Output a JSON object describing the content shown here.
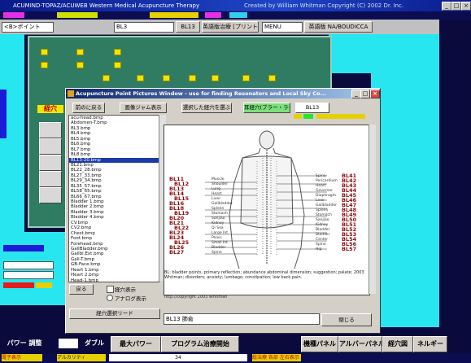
{
  "main_window": {
    "title": "ACUMIND-TOPAZ/ACUWEB   Western Medical Acupuncture Therapy",
    "subtitle": "Created by William Whitman  Copyright (C) 2002 Dr. Inc."
  },
  "toolbar": {
    "field_left": "<B>ポイント",
    "field_mid": "BL3",
    "button_1": "BL13",
    "button_2": "英語版治療 [プリントルーチン]",
    "field_3": "MENU",
    "button_4": "英語版 NA/BOUDICCA"
  },
  "green_panel": {
    "side_label": "経穴"
  },
  "acu_window": {
    "title": "Acupuncture Point Pictures Window - use for finding Resonators and Local Sky Co...",
    "buttons": {
      "prev": "前のに戻る",
      "view": "画像ジャム表示",
      "select_all": "選択した経穴を選ぶ",
      "ear": "耳経穴(ブラー・ラーズ)",
      "code": "BL13"
    },
    "checkbox_label": "経穴番号表示",
    "files": [
      "acu-head.bmp",
      "Abdomen-T.bmp",
      "BL3.bmp",
      "BL4.bmp",
      "BL5.bmp",
      "BL6.bmp",
      "BL7.bmp",
      "BL8.bmp",
      "BL13-20.bmp",
      "BL21.bmp",
      "BL22_28.bmp",
      "BL27_33.bmp",
      "BL29_34.bmp",
      "BL35_57.bmp",
      "BL58_65.bmp",
      "BL66_67.bmp",
      "Bladder 1.bmp",
      "Bladder 2.bmp",
      "Bladder 3.bmp",
      "Bladder 4.bmp",
      "CV.bmp",
      "CV2.bmp",
      "Chest.bmp",
      "Foot.bmp",
      "Forehead.bmp",
      "GallBladder.bmp",
      "Gallbl.Ext.bmp",
      "Gall-T.bmp",
      "GB-Face.bmp",
      "Heart 1.bmp",
      "Heart 2.bmp",
      "Head-1.bmp"
    ],
    "selected_index": 8,
    "figure_labels_left": [
      "BL11",
      "BL12",
      "BL13",
      "BL14",
      "BL15",
      "BL16",
      "BL18",
      "BL19",
      "BL20",
      "BL21",
      "BL22",
      "BL23",
      "BL24",
      "BL25",
      "BL26",
      "BL27"
    ],
    "figure_labels_right": [
      "BL41",
      "BL42",
      "BL43",
      "BL44",
      "BL45",
      "BL46",
      "BL47",
      "BL48",
      "BL49",
      "BL50",
      "BL51",
      "BL52",
      "BL53",
      "BL54",
      "BL56",
      "BL57"
    ],
    "small_left": [
      "Muscle",
      "Shoulder",
      "Lung",
      "Heart",
      "Liver",
      "Gallbladder",
      "Spleen",
      "Stomach",
      "Sanjiao",
      "Kidney",
      "Qi Sea",
      "Large Int.",
      "Pelvic",
      "Small Int.",
      "Bladder",
      "Spine"
    ],
    "small_right": [
      "Spine",
      "Pericardium",
      "Heart",
      "Governor",
      "Diaphragm",
      "Liver",
      "Gallbladder",
      "Spleen",
      "Stomach",
      "Sanjiao",
      "Kidney",
      "Bladder",
      "Bladder",
      "Center",
      "Spine",
      "Hip"
    ],
    "caption": "BL: bladder points, primary reflection; abundance abdominal dimension; suggestion; palate; 2003 Whitman; disorders; anxiety; lumbago; constipation; low back pain.",
    "url": "http://copyright 2003 Whitman",
    "left_buttons": {
      "small": "戻る",
      "check": "経穴表示",
      "radio": "アナログ表示",
      "wide": "経穴選択リード"
    },
    "note_input": "BL13 肺兪",
    "close_button": "閉じる"
  },
  "bottom_bar": {
    "item_1": "パワー 調整",
    "item_2": "ダブル",
    "item_3": "最大パワー",
    "item_4": "プログラム治療開始",
    "item_5": "機種パネル",
    "item_6": "アルバーパネル",
    "item_7": "経穴図",
    "item_8": "ネルギー"
  },
  "status_bar": {
    "left": "電子表示",
    "mid": "アルカリティ",
    "mid2": "34",
    "right": "総治療 各部 左右表示"
  }
}
